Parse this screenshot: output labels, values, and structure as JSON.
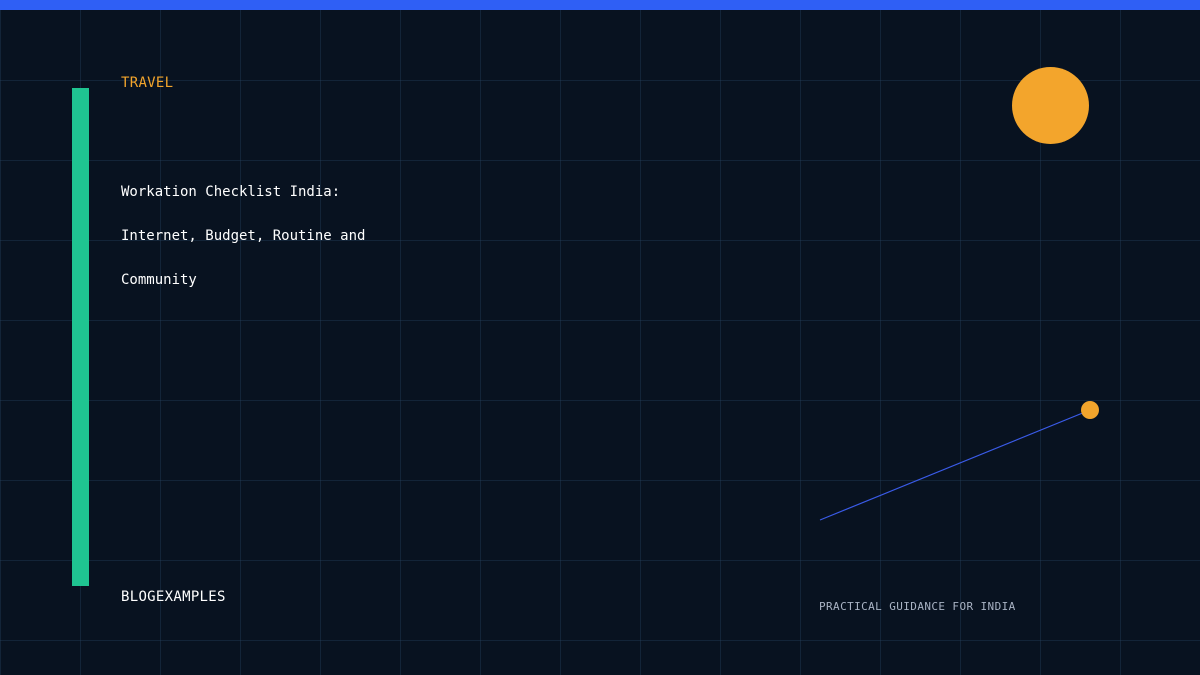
{
  "hero": {
    "category": "TRAVEL",
    "title_lines": [
      "Workation Checklist India:",
      "Internet, Budget, Routine and",
      "Community"
    ],
    "brand": "BLOGEXAMPLES",
    "tagline": "PRACTICAL GUIDANCE FOR INDIA"
  },
  "colors": {
    "background": "#081220",
    "top_bar": "#2f5ff5",
    "accent_bar": "#1fc491",
    "highlight": "#f3a52c",
    "line": "#3a5be8",
    "text": "#ffffff",
    "muted_text": "#a9b3c4"
  }
}
